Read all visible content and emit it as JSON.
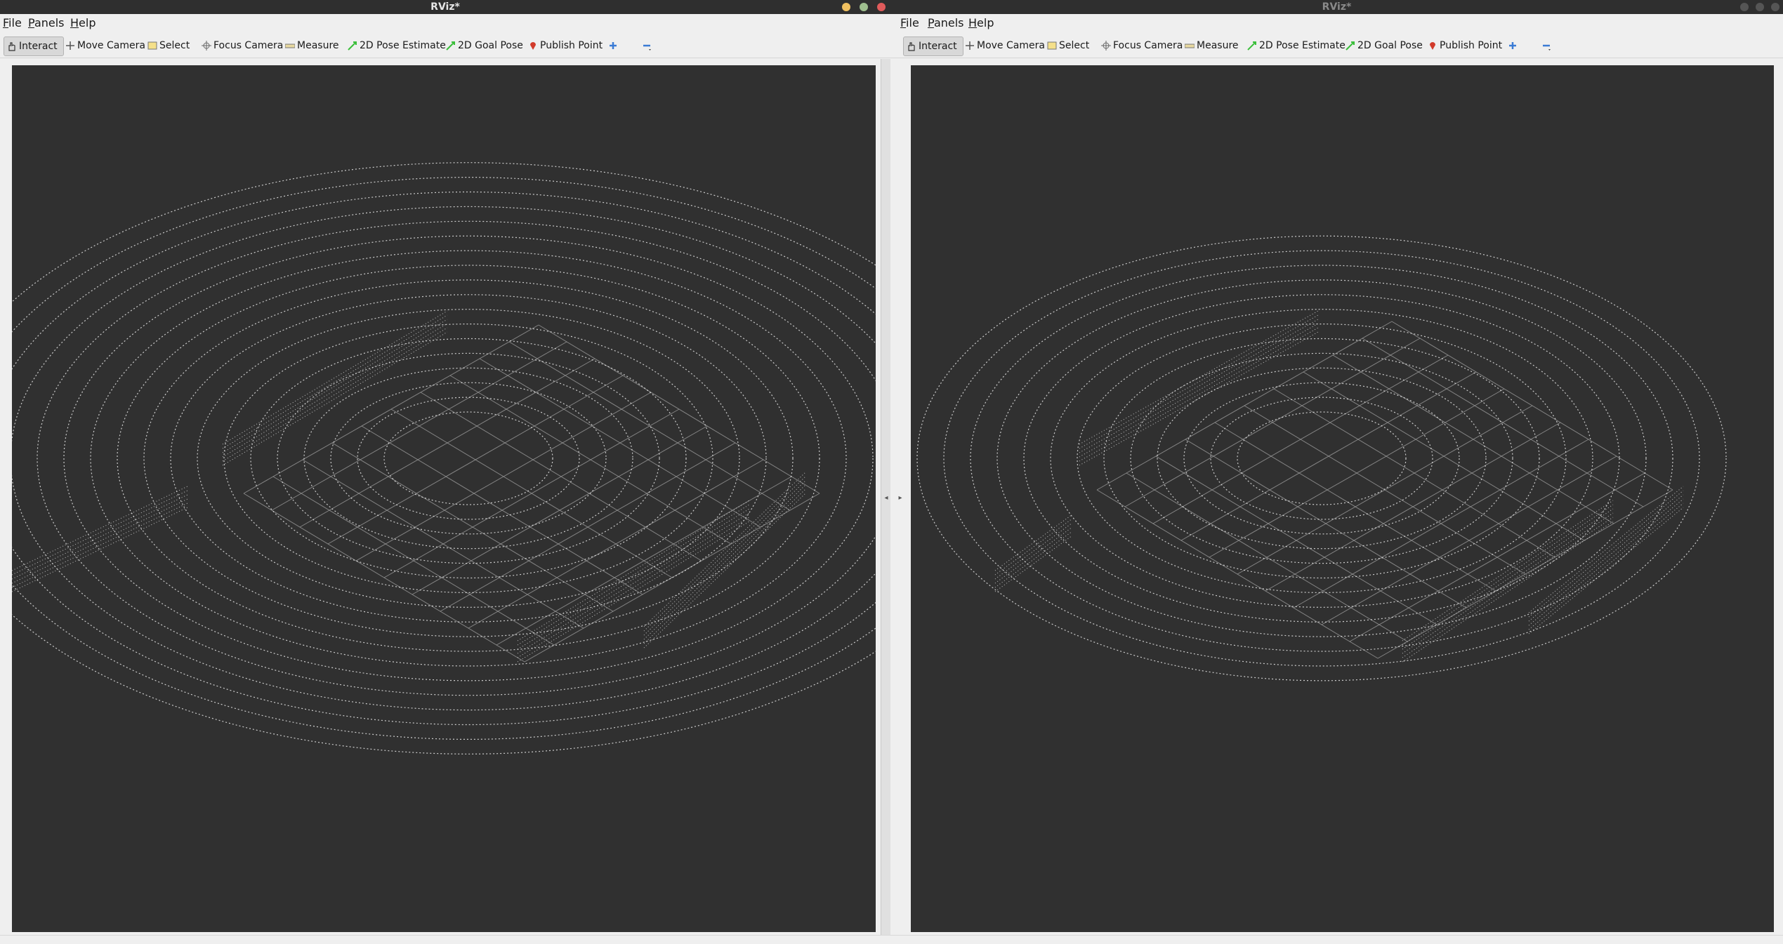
{
  "windows": [
    {
      "title": "RViz*",
      "menu": [
        {
          "accel": "F",
          "rest": "ile"
        },
        {
          "accel": "P",
          "rest": "anels"
        },
        {
          "accel": "H",
          "rest": "elp"
        }
      ],
      "tools": [
        {
          "label": "Interact",
          "icon": "hand-icon",
          "active": true
        },
        {
          "label": "Move Camera",
          "icon": "move-camera-icon"
        },
        {
          "label": "Select",
          "icon": "select-icon"
        },
        {
          "label": "Focus Camera",
          "icon": "focus-camera-icon"
        },
        {
          "label": "Measure",
          "icon": "ruler-icon"
        },
        {
          "label": "2D Pose Estimate",
          "icon": "green-arrow-icon"
        },
        {
          "label": "2D Goal Pose",
          "icon": "green-arrow-icon"
        },
        {
          "label": "Publish Point",
          "icon": "map-pin-icon"
        },
        {
          "label": "",
          "icon": "plus-icon"
        },
        {
          "label": "",
          "icon": "minus-icon"
        }
      ]
    },
    {
      "title": "RViz*",
      "menu": [
        {
          "accel": "F",
          "rest": "ile"
        },
        {
          "accel": "P",
          "rest": "anels"
        },
        {
          "accel": "H",
          "rest": "elp"
        }
      ],
      "tools": [
        {
          "label": "Interact",
          "icon": "hand-icon",
          "active": true
        },
        {
          "label": "Move Camera",
          "icon": "move-camera-icon"
        },
        {
          "label": "Select",
          "icon": "select-icon"
        },
        {
          "label": "Focus Camera",
          "icon": "focus-camera-icon"
        },
        {
          "label": "Measure",
          "icon": "ruler-icon"
        },
        {
          "label": "2D Pose Estimate",
          "icon": "green-arrow-icon"
        },
        {
          "label": "2D Goal Pose",
          "icon": "green-arrow-icon"
        },
        {
          "label": "Publish Point",
          "icon": "map-pin-icon"
        },
        {
          "label": "",
          "icon": "plus-icon"
        },
        {
          "label": "",
          "icon": "minus-icon"
        }
      ]
    }
  ],
  "colors": {
    "viewport_bg": "#303030",
    "grid": "#a0a0a0",
    "points": "#ffffff",
    "close": "#e05b5b",
    "maximize": "#9fbf8f",
    "minimize": "#f0c060"
  }
}
